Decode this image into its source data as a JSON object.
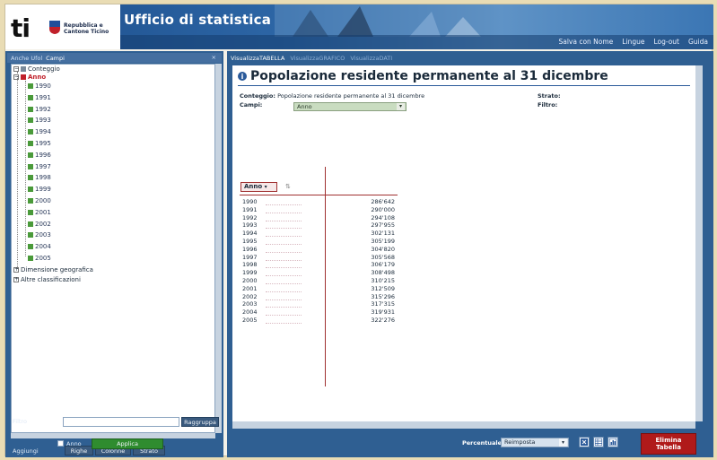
{
  "header": {
    "logo_text": "ti",
    "logo_subtitle_1": "Repubblica e",
    "logo_subtitle_2": "Cantone Ticino",
    "brand": "Ufficio di statistica",
    "nav": [
      "Salva con Nome",
      "Lingue",
      "Log-out",
      "Guida"
    ]
  },
  "left": {
    "tabs": [
      "Anche Ufol",
      "Campi"
    ],
    "close": "×",
    "tree": {
      "conteggio": "Conteggio",
      "anno": "Anno",
      "years": [
        "1990",
        "1991",
        "1992",
        "1993",
        "1994",
        "1995",
        "1996",
        "1997",
        "1998",
        "1999",
        "2000",
        "2001",
        "2002",
        "2003",
        "2004",
        "2005"
      ],
      "dimensione": "Dimensione geografica",
      "altre": "Altre classificazioni"
    },
    "bottom": {
      "aggiungi_label": "Aggiungi",
      "righe": "Righe",
      "colonne": "Colonne",
      "strato": "Strato",
      "filtro_label": "Filtro",
      "riaggiungi": "Raggruppa",
      "anno_label": "Anno",
      "applica": "Applica"
    }
  },
  "main": {
    "tabs": [
      "VisualizzaTABELLA",
      "VisualizzaGRAFICO",
      "VisualizzaDATI"
    ],
    "title": "Popolazione residente permanente al 31 dicembre",
    "conteggio_label": "Conteggio:",
    "conteggio_value": "Popolazione residente permanente al 31 dicembre",
    "campi_label": "Campi:",
    "campi_value": "Anno",
    "strato_label": "Strato:",
    "filtro_label": "Filtro:",
    "row_header": "Anno",
    "rows": [
      {
        "year": "1990",
        "value": "286'642"
      },
      {
        "year": "1991",
        "value": "290'000"
      },
      {
        "year": "1992",
        "value": "294'108"
      },
      {
        "year": "1993",
        "value": "297'955"
      },
      {
        "year": "1994",
        "value": "302'131"
      },
      {
        "year": "1995",
        "value": "305'199"
      },
      {
        "year": "1996",
        "value": "304'820"
      },
      {
        "year": "1997",
        "value": "305'568"
      },
      {
        "year": "1998",
        "value": "306'179"
      },
      {
        "year": "1999",
        "value": "308'498"
      },
      {
        "year": "2000",
        "value": "310'215"
      },
      {
        "year": "2001",
        "value": "312'509"
      },
      {
        "year": "2002",
        "value": "315'296"
      },
      {
        "year": "2003",
        "value": "317'315"
      },
      {
        "year": "2004",
        "value": "319'931"
      },
      {
        "year": "2005",
        "value": "322'276"
      }
    ],
    "footer": {
      "percentuale_label": "Percentuale:",
      "percentuale_value": "Reimposta",
      "delete_line1": "Elimina",
      "delete_line2": "Tabella"
    }
  },
  "colors": {
    "header_blue": "#2d66a6",
    "panel_blue": "#2f5f92",
    "apply_green": "#2f8c2f",
    "delete_red": "#b01a1a",
    "accent_red": "#c0202a"
  }
}
